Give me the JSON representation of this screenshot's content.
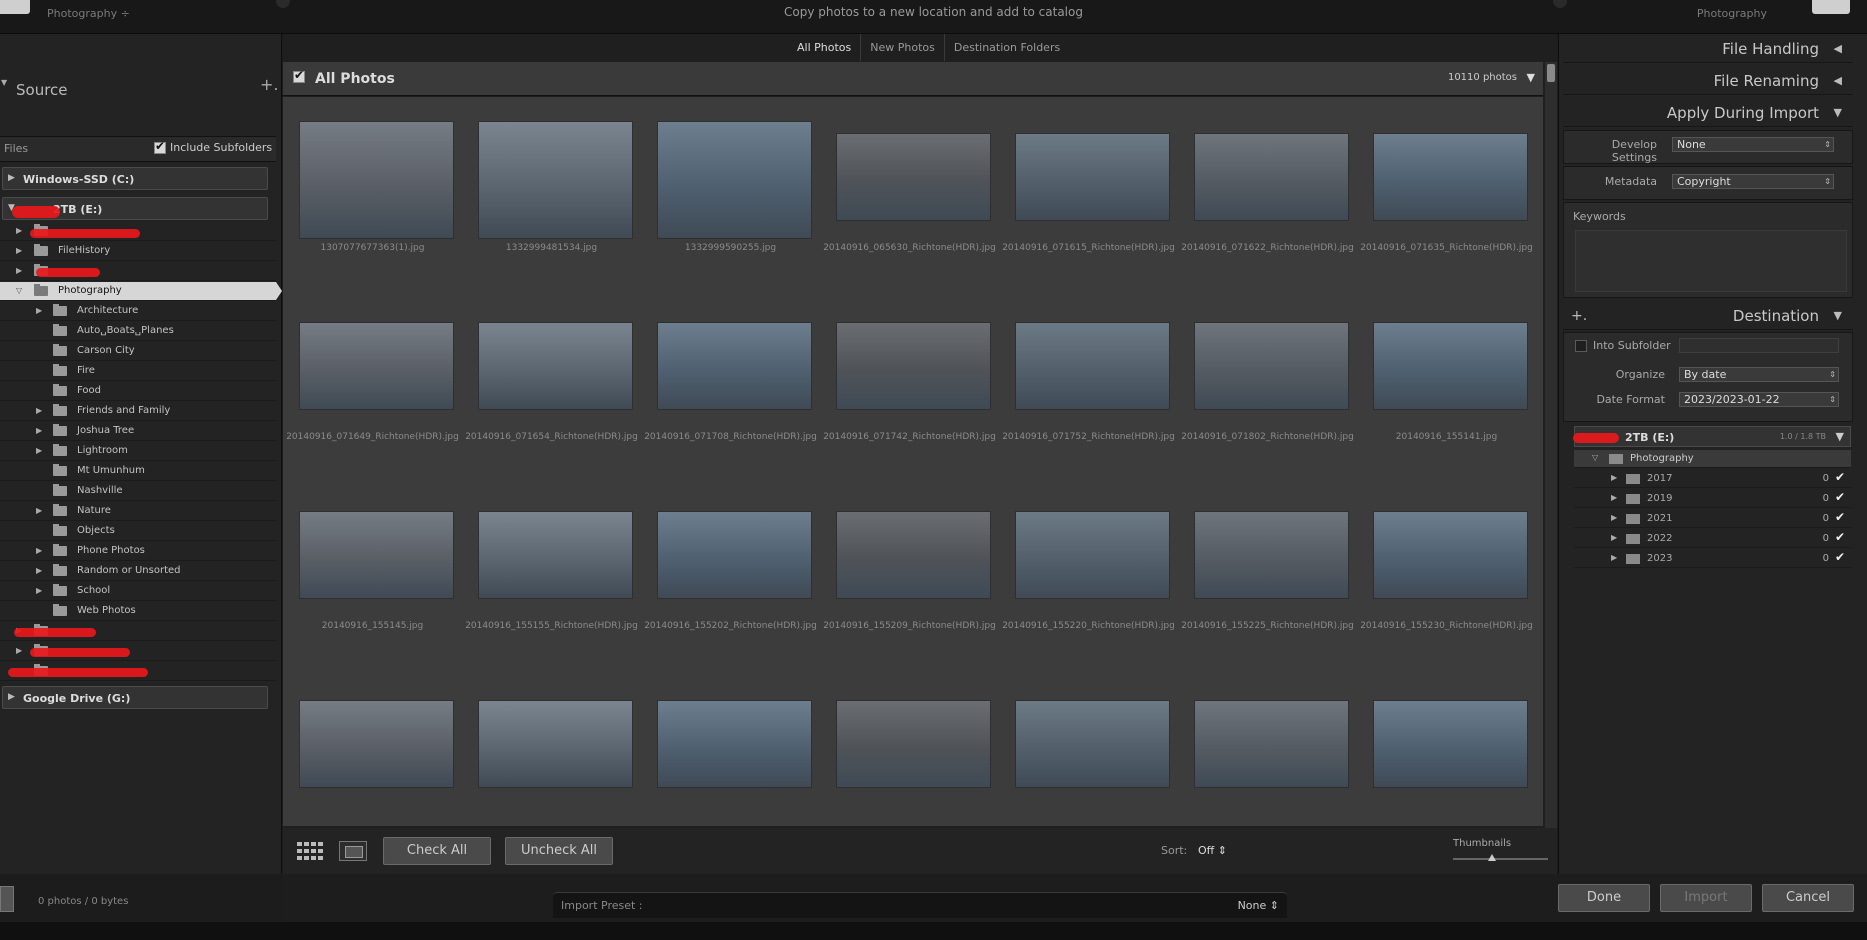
{
  "top": {
    "source_sub": "Photography ÷",
    "center_message": "Copy photos to a new location and add to catalog",
    "dest_sub": "Photography"
  },
  "tabs": [
    "All Photos",
    "New Photos",
    "Destination Folders"
  ],
  "source": {
    "title": "Source",
    "plus": "+.",
    "files_label": "Files",
    "include_subfolders": "Include Subfolders",
    "volumes": {
      "windows": "Windows-SSD (C:)",
      "external": "2TB (E:)",
      "google": "Google Drive (G:)"
    },
    "tree": [
      {
        "label": "FileHistory"
      },
      {
        "label": "Photography"
      },
      {
        "label": "Architecture"
      },
      {
        "label": "Auto␣Boats␣Planes"
      },
      {
        "label": "Carson City"
      },
      {
        "label": "Fire"
      },
      {
        "label": "Food"
      },
      {
        "label": "Friends and Family"
      },
      {
        "label": "Joshua Tree"
      },
      {
        "label": "Lightroom"
      },
      {
        "label": "Mt Umunhum"
      },
      {
        "label": "Nashville"
      },
      {
        "label": "Nature"
      },
      {
        "label": "Objects"
      },
      {
        "label": "Phone Photos"
      },
      {
        "label": "Random or Unsorted"
      },
      {
        "label": "School"
      },
      {
        "label": "Web Photos"
      }
    ],
    "status": "0 photos / 0 bytes"
  },
  "grid": {
    "title": "All Photos",
    "count": "10110 photos",
    "dropdown": "▼",
    "captions": [
      "1307077677363(1).jpg",
      "1332999481534.jpg",
      "1332999590255.jpg",
      "20140916_065630_Richtone(HDR).jpg",
      "20140916_071615_Richtone(HDR).jpg",
      "20140916_071622_Richtone(HDR).jpg",
      "20140916_071635_Richtone(HDR).jpg",
      "20140916_071649_Richtone(HDR).jpg",
      "20140916_071654_Richtone(HDR).jpg",
      "20140916_071708_Richtone(HDR).jpg",
      "20140916_071742_Richtone(HDR).jpg",
      "20140916_071752_Richtone(HDR).jpg",
      "20140916_071802_Richtone(HDR).jpg",
      "20140916_155141.jpg",
      "20140916_155145.jpg",
      "20140916_155155_Richtone(HDR).jpg",
      "20140916_155202_Richtone(HDR).jpg",
      "20140916_155209_Richtone(HDR).jpg",
      "20140916_155220_Richtone(HDR).jpg",
      "20140916_155225_Richtone(HDR).jpg",
      "20140916_155230_Richtone(HDR).jpg",
      "",
      "",
      "",
      "",
      "",
      "",
      ""
    ]
  },
  "toolbar": {
    "check_all": "Check All",
    "uncheck_all": "Uncheck All",
    "sort_label": "Sort:",
    "sort_value": "Off ⇕",
    "thumbnails_label": "Thumbnails"
  },
  "right": {
    "file_handling": "File Handling",
    "file_renaming": "File Renaming",
    "apply_during_import": "Apply During Import",
    "develop_settings_label": "Develop Settings",
    "develop_settings_value": "None",
    "metadata_label": "Metadata",
    "metadata_value": "Copyright",
    "keywords_label": "Keywords",
    "destination": "Destination",
    "into_subfolder": "Into Subfolder",
    "organize_label": "Organize",
    "organize_value": "By date",
    "date_format_label": "Date Format",
    "date_format_value": "2023/2023-01-22",
    "dest_volume": "2TB (E:)",
    "dest_volume_space": "1.0 / 1.8 TB",
    "dest_folder": "Photography",
    "years": [
      {
        "label": "2017",
        "count": "0"
      },
      {
        "label": "2019",
        "count": "0"
      },
      {
        "label": "2021",
        "count": "0"
      },
      {
        "label": "2022",
        "count": "0"
      },
      {
        "label": "2023",
        "count": "0"
      }
    ]
  },
  "footer": {
    "import_preset_label": "Import Preset :",
    "import_preset_value": "None ⇕",
    "done": "Done",
    "import": "Import",
    "cancel": "Cancel"
  }
}
